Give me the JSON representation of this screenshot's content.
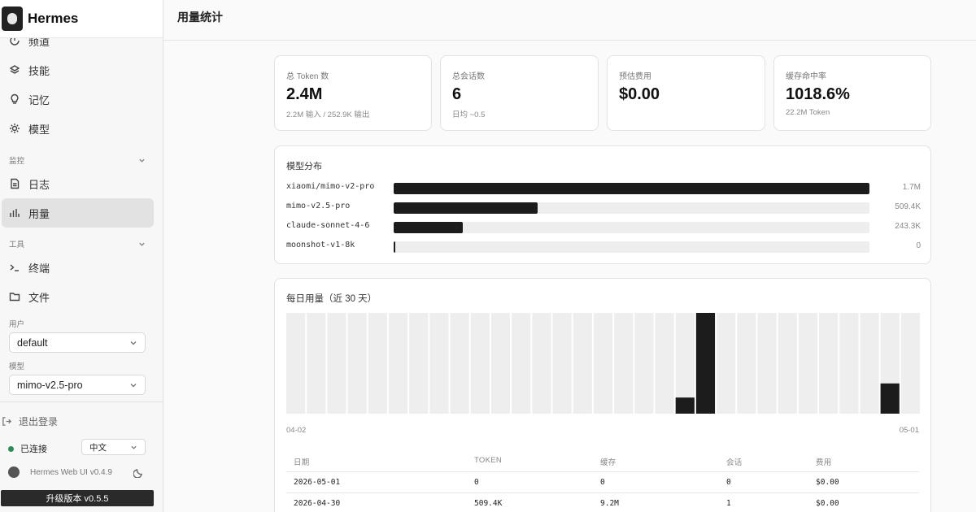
{
  "sidebar": {
    "brand": "Hermes",
    "nav_top": [
      {
        "label": "频道",
        "icon": "channel-icon"
      },
      {
        "label": "技能",
        "icon": "layers-icon"
      },
      {
        "label": "记忆",
        "icon": "lightbulb-icon"
      },
      {
        "label": "模型",
        "icon": "sun-gear-icon"
      }
    ],
    "section_monitor": "监控",
    "nav_monitor": [
      {
        "label": "日志",
        "icon": "document-icon"
      },
      {
        "label": "用量",
        "icon": "bar-chart-icon",
        "active": true
      }
    ],
    "section_tools": "工具",
    "nav_tools": [
      {
        "label": "终端",
        "icon": "terminal-icon"
      },
      {
        "label": "文件",
        "icon": "folder-icon"
      }
    ],
    "user_label": "用户",
    "user_value": "default",
    "model_label": "模型",
    "model_value": "mimo-v2.5-pro",
    "logout": "退出登录",
    "connection": "已连接",
    "language": "中文",
    "version": "Hermes Web UI v0.4.9",
    "upgrade": "升级版本 v0.5.5"
  },
  "header": {
    "title": "用量统计"
  },
  "stats": [
    {
      "label": "总 Token 数",
      "value": "2.4M",
      "sub": "2.2M 输入 / 252.9K 输出"
    },
    {
      "label": "总会话数",
      "value": "6",
      "sub": "日均 ~0.5"
    },
    {
      "label": "预估费用",
      "value": "$0.00",
      "sub": ""
    },
    {
      "label": "缓存命中率",
      "value": "1018.6%",
      "sub": "22.2M Token"
    }
  ],
  "model_dist": {
    "title": "模型分布",
    "rows": [
      {
        "name": "xiaomi/mimo-v2-pro",
        "amount": "1.7M",
        "fraction": 1.0
      },
      {
        "name": "mimo-v2.5-pro",
        "amount": "509.4K",
        "fraction": 0.303
      },
      {
        "name": "claude-sonnet-4-6",
        "amount": "243.3K",
        "fraction": 0.145
      },
      {
        "name": "moonshot-v1-8k",
        "amount": "0",
        "fraction": 0.0
      }
    ]
  },
  "daily": {
    "title": "每日用量（近 30 天）",
    "x_start": "04-02",
    "x_end": "05-01"
  },
  "chart_data": {
    "type": "bar",
    "title": "每日用量（近 30 天）",
    "x_start_label": "04-02",
    "x_end_label": "05-01",
    "highlight_color": "#1c1c1c",
    "bg_color": "#eeeeee",
    "values": [
      0,
      0,
      0,
      0,
      0,
      0,
      0,
      0,
      0,
      0,
      0,
      0,
      0,
      0,
      0,
      0,
      0,
      0,
      0,
      0.16,
      1.0,
      0,
      0,
      0,
      0,
      0,
      0,
      0,
      0,
      0.3,
      0
    ],
    "grid": false,
    "legend": "none"
  },
  "table": {
    "headers": [
      "日期",
      "TOKEN",
      "缓存",
      "会话",
      "费用"
    ],
    "rows": [
      [
        "2026-05-01",
        "0",
        "0",
        "0",
        "$0.00"
      ],
      [
        "2026-04-30",
        "509.4K",
        "9.2M",
        "1",
        "$0.00"
      ]
    ]
  }
}
